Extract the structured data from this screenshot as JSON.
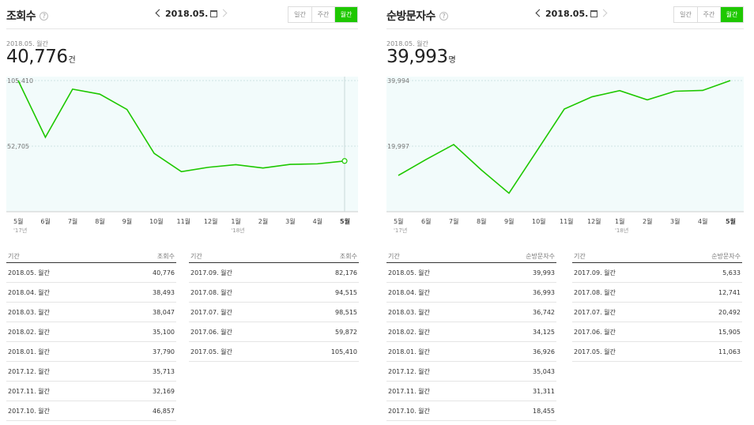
{
  "panels": [
    {
      "title": "조회수",
      "help": "?",
      "nav_date": "2018.05.",
      "periods": [
        "일간",
        "주간",
        "월간"
      ],
      "active_period": 2,
      "subdate": "2018.05. 월간",
      "value": "40,776",
      "unit": "건",
      "chart_data": {
        "type": "line",
        "categories": [
          "5월",
          "6월",
          "7월",
          "8월",
          "9월",
          "10월",
          "11월",
          "12월",
          "1월",
          "2월",
          "3월",
          "4월",
          "5월"
        ],
        "year_labels": {
          "0": "'17년",
          "8": "'18년"
        },
        "yticks": [
          {
            "value": 105410,
            "label": "105,410"
          },
          {
            "value": 52705,
            "label": "52,705"
          }
        ],
        "ylim": [
          0,
          105410
        ],
        "values": [
          105410,
          59872,
          98515,
          94515,
          82176,
          46857,
          32169,
          35713,
          37790,
          35100,
          38047,
          38493,
          40776
        ],
        "highlight_index": 12,
        "line_color": "#1ec800"
      },
      "table_left": {
        "col1": "기간",
        "col2": "조회수",
        "rows": [
          [
            "2018.05. 월간",
            "40,776"
          ],
          [
            "2018.04. 월간",
            "38,493"
          ],
          [
            "2018.03. 월간",
            "38,047"
          ],
          [
            "2018.02. 월간",
            "35,100"
          ],
          [
            "2018.01. 월간",
            "37,790"
          ],
          [
            "2017.12. 월간",
            "35,713"
          ],
          [
            "2017.11. 월간",
            "32,169"
          ],
          [
            "2017.10. 월간",
            "46,857"
          ]
        ]
      },
      "table_right": {
        "col1": "기간",
        "col2": "조회수",
        "rows": [
          [
            "2017.09. 월간",
            "82,176"
          ],
          [
            "2017.08. 월간",
            "94,515"
          ],
          [
            "2017.07. 월간",
            "98,515"
          ],
          [
            "2017.06. 월간",
            "59,872"
          ],
          [
            "2017.05. 월간",
            "105,410"
          ]
        ]
      }
    },
    {
      "title": "순방문자수",
      "help": "?",
      "nav_date": "2018.05.",
      "periods": [
        "일간",
        "주간",
        "월간"
      ],
      "active_period": 2,
      "subdate": "2018.05. 월간",
      "value": "39,993",
      "unit": "명",
      "chart_data": {
        "type": "line",
        "categories": [
          "5월",
          "6월",
          "7월",
          "8월",
          "9월",
          "10월",
          "11월",
          "12월",
          "1월",
          "2월",
          "3월",
          "4월",
          "5월"
        ],
        "year_labels": {
          "0": "'17년",
          "8": "'18년"
        },
        "yticks": [
          {
            "value": 39994,
            "label": "39,994"
          },
          {
            "value": 19997,
            "label": "19,997"
          }
        ],
        "ylim": [
          0,
          39994
        ],
        "values": [
          11063,
          15905,
          20492,
          12741,
          5633,
          18455,
          31311,
          35043,
          36926,
          34125,
          36742,
          36993,
          39993
        ],
        "highlight_index": -1,
        "line_color": "#1ec800"
      },
      "table_left": {
        "col1": "기간",
        "col2": "순방문자수",
        "rows": [
          [
            "2018.05. 월간",
            "39,993"
          ],
          [
            "2018.04. 월간",
            "36,993"
          ],
          [
            "2018.03. 월간",
            "36,742"
          ],
          [
            "2018.02. 월간",
            "34,125"
          ],
          [
            "2018.01. 월간",
            "36,926"
          ],
          [
            "2017.12. 월간",
            "35,043"
          ],
          [
            "2017.11. 월간",
            "31,311"
          ],
          [
            "2017.10. 월간",
            "18,455"
          ]
        ]
      },
      "table_right": {
        "col1": "기간",
        "col2": "순방문자수",
        "rows": [
          [
            "2017.09. 월간",
            "5,633"
          ],
          [
            "2017.08. 월간",
            "12,741"
          ],
          [
            "2017.07. 월간",
            "20,492"
          ],
          [
            "2017.06. 월간",
            "15,905"
          ],
          [
            "2017.05. 월간",
            "11,063"
          ]
        ]
      }
    }
  ]
}
